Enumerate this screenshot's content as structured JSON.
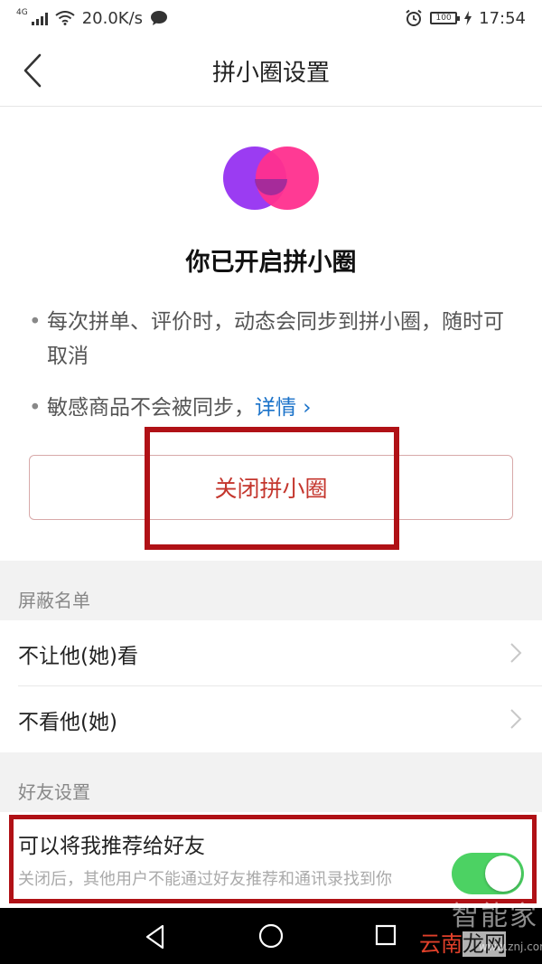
{
  "status_bar": {
    "network": "4G",
    "speed": "20.0K/s",
    "battery": "100",
    "time": "17:54"
  },
  "nav": {
    "title": "拼小圈设置"
  },
  "hero": {
    "title": "你已开启拼小圈",
    "bullet_1": "每次拼单、评价时，动态会同步到拼小圈，随时可取消",
    "bullet_2_text": "敏感商品不会被同步，",
    "bullet_2_link": "详情 ›",
    "close_button": "关闭拼小圈"
  },
  "block_list": {
    "header": "屏蔽名单",
    "items": [
      {
        "label": "不让他(她)看"
      },
      {
        "label": "不看他(她)"
      }
    ]
  },
  "friend_settings": {
    "header": "好友设置",
    "recommend_title": "可以将我推荐给好友",
    "recommend_desc": "关闭后，其他用户不能通过好友推荐和通讯录找到你",
    "recommend_enabled": true
  },
  "watermark": {
    "big": "智能家",
    "brand_1": "云南",
    "brand_2": "龙网",
    "url": "www.znj.com"
  },
  "colors": {
    "accent_red": "#c4362d",
    "toggle_green": "#4cd263",
    "link_blue": "#1a72c9",
    "annotation_red": "#b01116"
  }
}
